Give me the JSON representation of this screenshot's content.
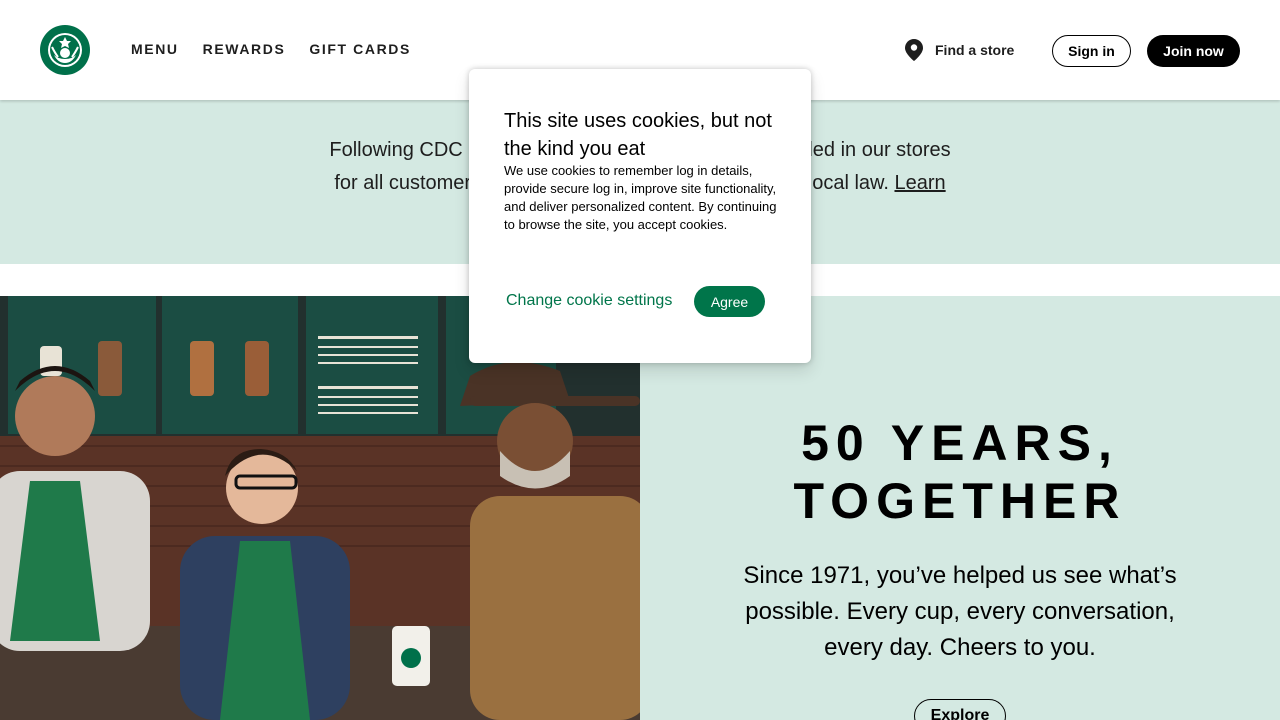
{
  "header": {
    "nav": [
      "MENU",
      "REWARDS",
      "GIFT CARDS"
    ],
    "find_store": "Find a store",
    "sign_in": "Sign in",
    "join_now": "Join now"
  },
  "banner": {
    "text_part1": "Following CDC gu",
    "text_part2": "ded in our stores",
    "text_part3": "for all customers",
    "text_part4": "y local law.",
    "link": "Learn"
  },
  "hero": {
    "title_line1": "50 YEARS,",
    "title_line2": "TOGETHER",
    "subtitle": "Since 1971, you’ve helped us see what’s possible. Every cup, every conversation, every day. Cheers to you.",
    "explore": "Explore"
  },
  "cookie": {
    "title": "This site uses cookies, but not the kind you eat",
    "body": "We use cookies to remember log in details, provide secure log in, improve site functionality, and deliver personalized content. By continuing to browse the site, you accept cookies.",
    "change_settings": "Change cookie settings",
    "agree": "Agree"
  },
  "colors": {
    "brand_green": "#00754a",
    "light_green": "#d4e9e2",
    "logo_green": "#00704a"
  },
  "icons": {
    "logo": "starbucks-siren-logo",
    "location": "map-pin-icon"
  }
}
